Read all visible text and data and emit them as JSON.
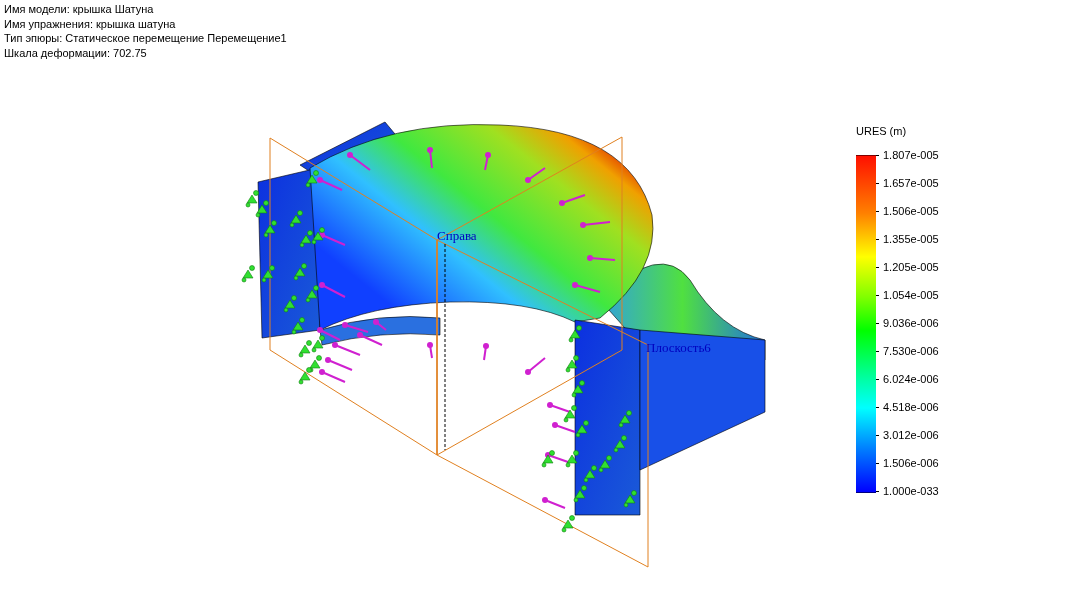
{
  "info_lines": [
    "Имя модели: крышка Шатуна",
    "Имя упражнения: крышка шатуна",
    "Тип эпюры: Статическое перемещение Перемещение1",
    "Шкала деформации: 702.75"
  ],
  "planes": [
    {
      "label": "Справа"
    },
    {
      "label": "Плоскость6"
    }
  ],
  "legend": {
    "title": "URES (m)",
    "ticks": [
      "1.807e-005",
      "1.657e-005",
      "1.506e-005",
      "1.355e-005",
      "1.205e-005",
      "1.054e-005",
      "9.036e-006",
      "7.530e-006",
      "6.024e-006",
      "4.518e-006",
      "3.012e-006",
      "1.506e-006",
      "1.000e-033"
    ]
  }
}
